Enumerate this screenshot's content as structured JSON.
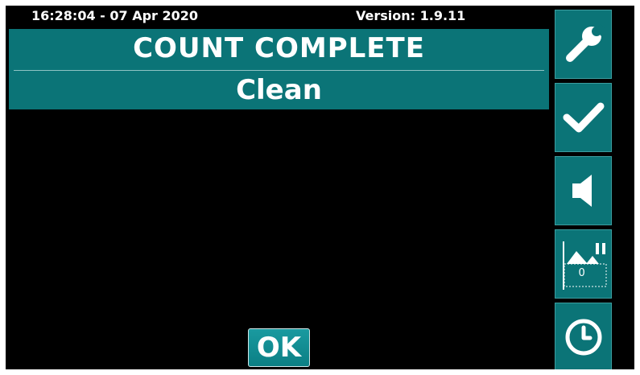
{
  "status": {
    "datetime": "16:28:04 - 07 Apr 2020",
    "version": "Version: 1.9.11"
  },
  "banner": {
    "title": "COUNT COMPLETE",
    "subtitle": "Clean"
  },
  "actions": {
    "ok_label": "OK"
  },
  "sidebar": {
    "buttons": [
      {
        "icon": "wrench-icon"
      },
      {
        "icon": "checkmark-icon"
      },
      {
        "icon": "speaker-icon"
      },
      {
        "icon": "histogram-icon",
        "readout": "0"
      },
      {
        "icon": "clock-icon"
      }
    ]
  },
  "colors": {
    "accent": "#0b7477",
    "screen_background": "#000000",
    "text": "#ffffff"
  }
}
